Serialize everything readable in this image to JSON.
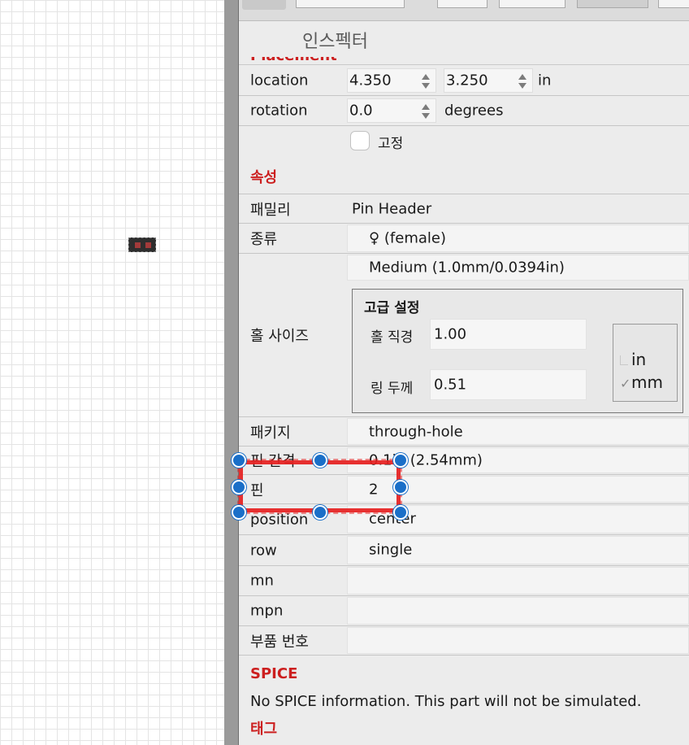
{
  "inspector": {
    "title": "인스펙터",
    "cut_section": "Placement"
  },
  "placement": {
    "location_label": "location",
    "location_x": "4.350",
    "location_y": "3.250",
    "location_unit": "in",
    "rotation_label": "rotation",
    "rotation_value": "0.0",
    "rotation_unit": "degrees",
    "locked_label": "고정"
  },
  "properties": {
    "section_label": "속성",
    "family_label": "패밀리",
    "family_value": "Pin Header",
    "form_label": "종류",
    "form_value": "♀ (female)",
    "hole_size_label": "홀 사이즈",
    "hole_size_value": "Medium (1.0mm/0.0394in)",
    "advanced": {
      "title": "고급 설정",
      "hole_diameter_label": "홀 직경",
      "hole_diameter_value": "1.00",
      "ring_thickness_label": "링 두께",
      "ring_thickness_value": "0.51",
      "unit_in": "in",
      "unit_mm": "mm",
      "selected_unit": "mm"
    },
    "package_label": "패키지",
    "package_value": "through-hole",
    "pitch_label": "핀 간격",
    "pitch_value": "0.1in (2.54mm)",
    "pins_label": "핀",
    "pins_value": "2",
    "position_label": "position",
    "position_value": "center",
    "row_label": "row",
    "row_value": "single",
    "mn_label": "mn",
    "mpn_label": "mpn",
    "part_number_label": "부품 번호"
  },
  "spice": {
    "section_label": "SPICE",
    "text": "No SPICE information. This part will not be simulated."
  },
  "tags": {
    "section_label": "태그"
  },
  "colors": {
    "section_red": "#cc1f1f",
    "selection_red": "#e62020",
    "handle_blue": "#1a6fc8"
  }
}
